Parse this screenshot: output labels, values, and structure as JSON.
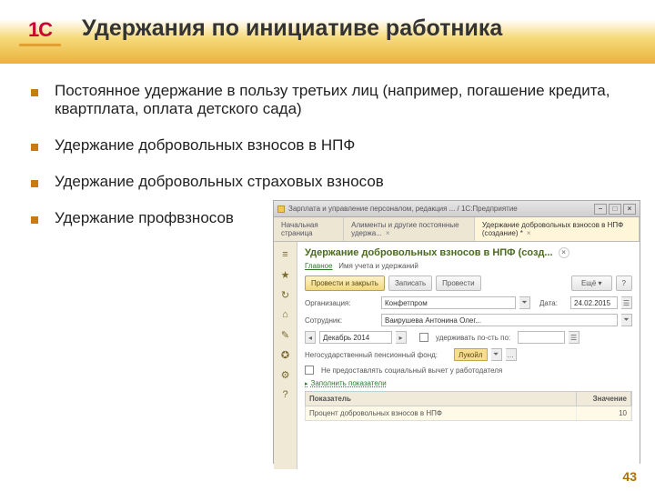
{
  "slide": {
    "title": "Удержания по инициативе работника",
    "bullets": [
      "Постоянное удержание в пользу третьих лиц (например, погашение кредита, квартплата, оплата детского сада)",
      "Удержание добровольных взносов в НПФ",
      "Удержание добровольных страховых взносов",
      "Удержание профвзносов"
    ],
    "page": "43",
    "logo": "1C"
  },
  "app": {
    "window_title": "Зарплата и управление персоналом, редакция ... / 1С:Предприятие",
    "win_buttons": {
      "min": "–",
      "max": "□",
      "close": "×"
    },
    "tabs": [
      {
        "label": "Начальная страница"
      },
      {
        "label": "Алименты и другие постоянные удержа..."
      },
      {
        "label": "Удержание добровольных взносов в НПФ (создание) *",
        "active": true
      }
    ],
    "sidebar_icons": [
      "≡",
      "★",
      "↻",
      "⌂",
      "✎",
      "✪",
      "⚙",
      "?"
    ],
    "form_title": "Удержание добровольных взносов в НПФ (созд...",
    "breadcrumb": {
      "main": "Главное",
      "sub": "Имя учета и удержаний"
    },
    "buttons": {
      "primary": "Провести и закрыть",
      "save": "Записать",
      "post": "Провести",
      "more": "Ещё ▾"
    },
    "fields": {
      "org_lbl": "Организация:",
      "org_val": "Конфетпром",
      "date_lbl": "Дата:",
      "date_val": "24.02.2015",
      "emp_lbl": "Сотрудник:",
      "emp_val": "Ваирушева Антонина Олег...",
      "period_lbl": "Декабрь 2014",
      "mode_lbl": "удерживать по-сть по:",
      "npf_lbl": "Негосударственный пенсионный фонд:",
      "npf_val": "Лукойл",
      "chk_lbl": "Не предоставлять социальный вычет у работодателя"
    },
    "section_link": "Заполнить показатели",
    "table": {
      "head1": "Показатель",
      "head2": "Значение",
      "cell1": "Процент добровольных взносов в НПФ",
      "cell2": "10"
    }
  }
}
